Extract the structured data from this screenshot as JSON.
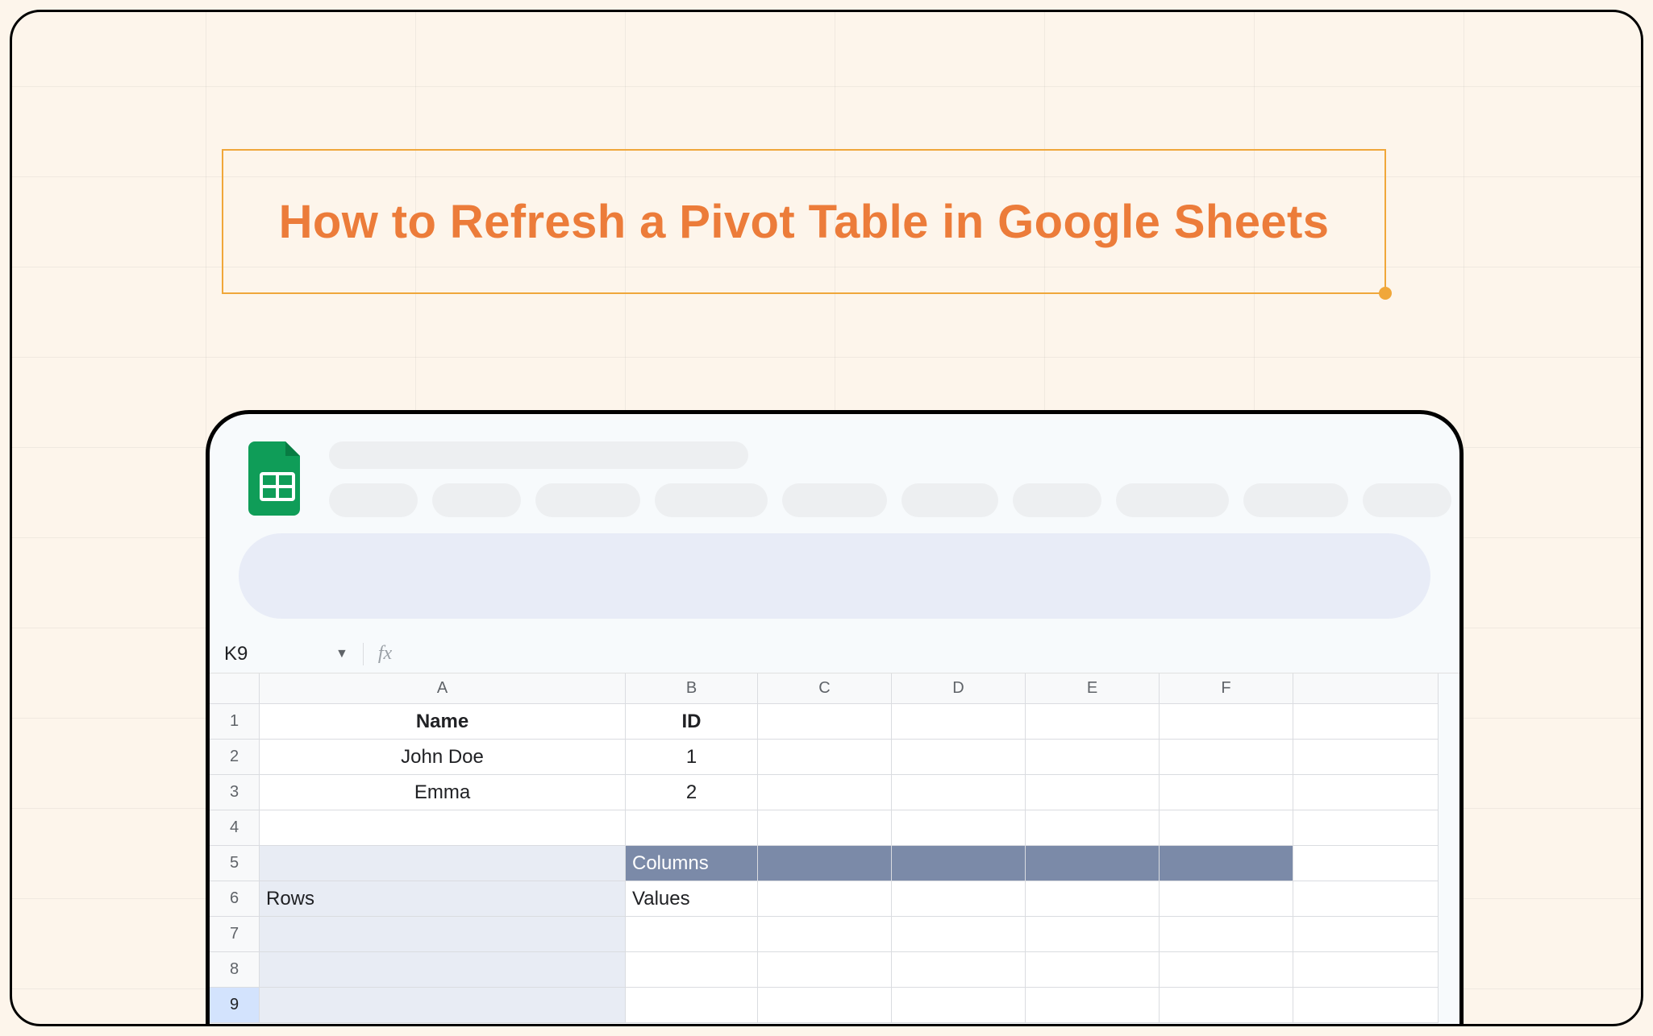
{
  "title": "How to Refresh a Pivot Table in Google Sheets",
  "cell_reference": "K9",
  "fx_label": "fx",
  "columns": [
    "A",
    "B",
    "C",
    "D",
    "E",
    "F"
  ],
  "rows": [
    "1",
    "2",
    "3",
    "4",
    "5",
    "6",
    "7",
    "8",
    "9"
  ],
  "data": {
    "r1": {
      "A": "Name",
      "B": "ID"
    },
    "r2": {
      "A": "John Doe",
      "B": "1"
    },
    "r3": {
      "A": "Emma",
      "B": "2"
    },
    "r5": {
      "B": "Columns"
    },
    "r6": {
      "A": "Rows",
      "B": "Values"
    }
  }
}
